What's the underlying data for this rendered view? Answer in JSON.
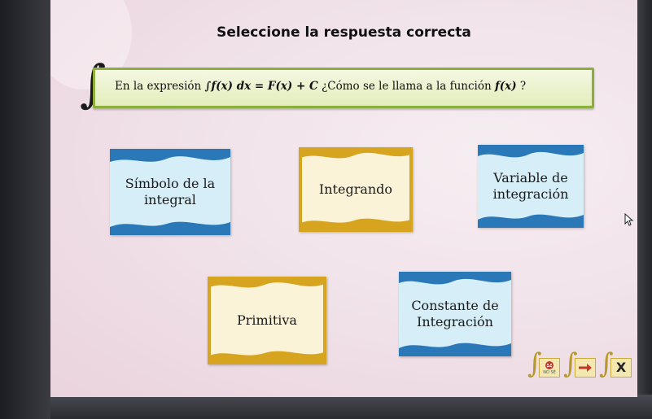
{
  "title": "Seleccione la respuesta correcta",
  "question": {
    "text_pre": "En la expresión ",
    "formula": "∫f(x) dx = F(x) + C",
    "text_post": " ¿Cómo se le llama a la función ",
    "func": "f(x)",
    "text_end": " ?",
    "integral_symbol": "∫"
  },
  "options": [
    {
      "label": "Símbolo de la\nintegral",
      "color": "#7fc6e4"
    },
    {
      "label": "Integrando",
      "color": "#e8c23c"
    },
    {
      "label": "Variable de\nintegración",
      "color": "#7fc6e4"
    },
    {
      "label": "Primitiva",
      "color": "#e8c23c"
    },
    {
      "label": "Constante de\nIntegración",
      "color": "#7fc6e4"
    }
  ],
  "toolbar": {
    "help_icon": "no-se-icon",
    "help_label": "NO SÉ",
    "next_icon": "arrow-right-icon",
    "close_icon": "close-x-icon",
    "integral_symbol": "∫",
    "close_glyph": "X"
  },
  "colors": {
    "question_border": "#8cae3c",
    "blue_wave": "#7fc6e4",
    "gold_wave": "#e8c23c",
    "card_fill": "#fbf3d8"
  }
}
